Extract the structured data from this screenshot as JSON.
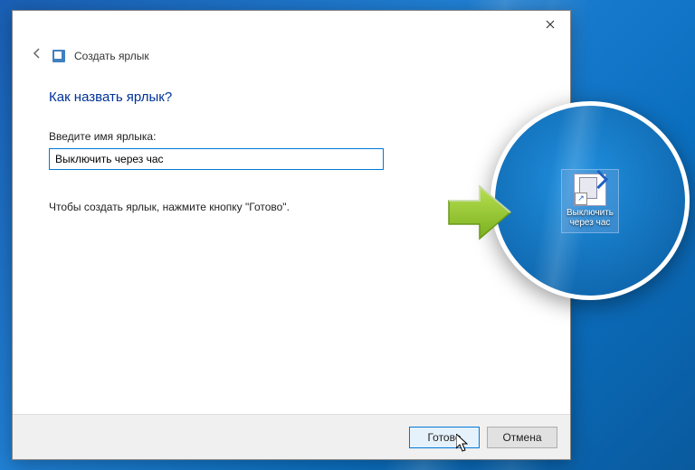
{
  "dialog": {
    "title": "Создать ярлык",
    "question": "Как назвать ярлык?",
    "field_label": "Введите имя ярлыка:",
    "input_value": "Выключить через час",
    "instruction": "Чтобы создать ярлык, нажмите кнопку \"Готово\".",
    "finish_label": "Готово",
    "cancel_label": "Отмена"
  },
  "shortcut": {
    "label_line1": "Выключить",
    "label_line2": "через час"
  }
}
